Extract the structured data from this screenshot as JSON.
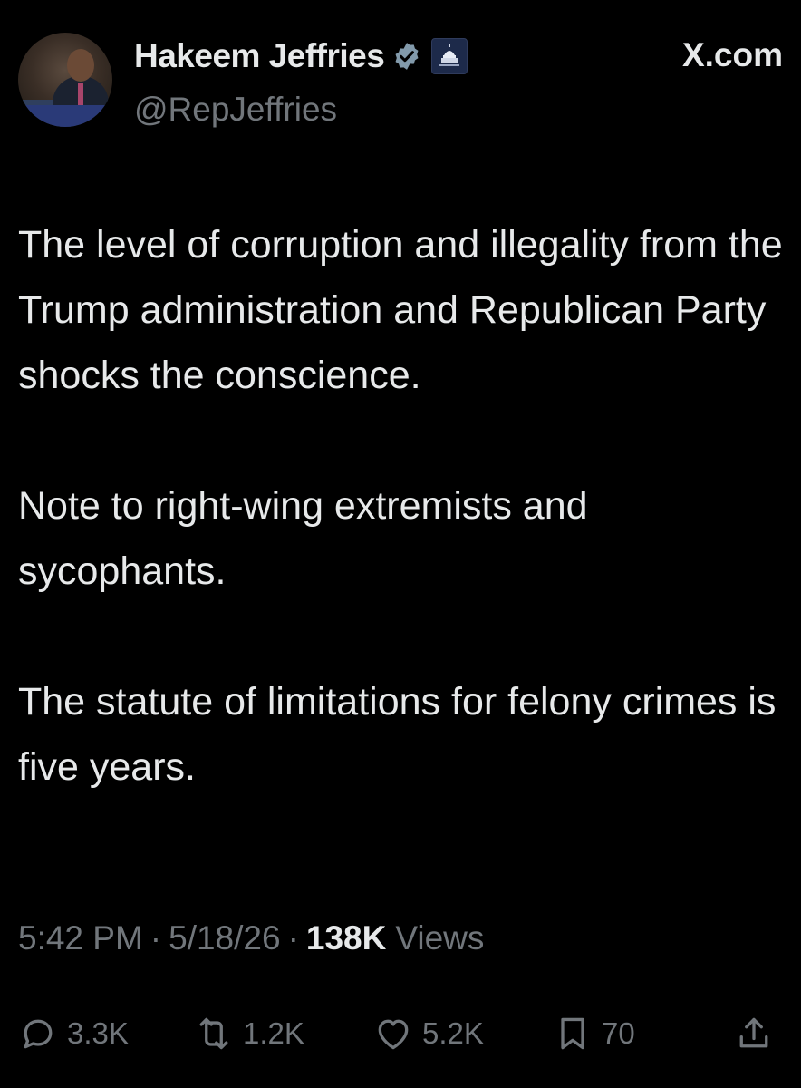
{
  "author": {
    "name": "Hakeem Jeffries",
    "handle": "@RepJeffries"
  },
  "site_label": "X.com",
  "tweet": {
    "paragraphs": [
      "The level of corruption and illegality from the Trump administration and Republican Party shocks the conscience.",
      "Note to right-wing extremists and sycophants.",
      "The statute of limitations for felony crimes is five years."
    ]
  },
  "meta": {
    "time": "5:42 PM",
    "date": "5/18/26",
    "views_count": "138K",
    "views_label": "Views",
    "separator": "·"
  },
  "actions": {
    "replies": "3.3K",
    "reposts": "1.2K",
    "likes": "5.2K",
    "bookmarks": "70"
  },
  "icons": {
    "verified": "verified-badge-icon",
    "org": "house-democrats-icon",
    "reply": "reply-icon",
    "repost": "repost-icon",
    "like": "heart-icon",
    "bookmark": "bookmark-icon",
    "share": "share-icon"
  },
  "colors": {
    "background": "#000000",
    "text": "#e7e9ea",
    "secondary": "#71767b"
  }
}
